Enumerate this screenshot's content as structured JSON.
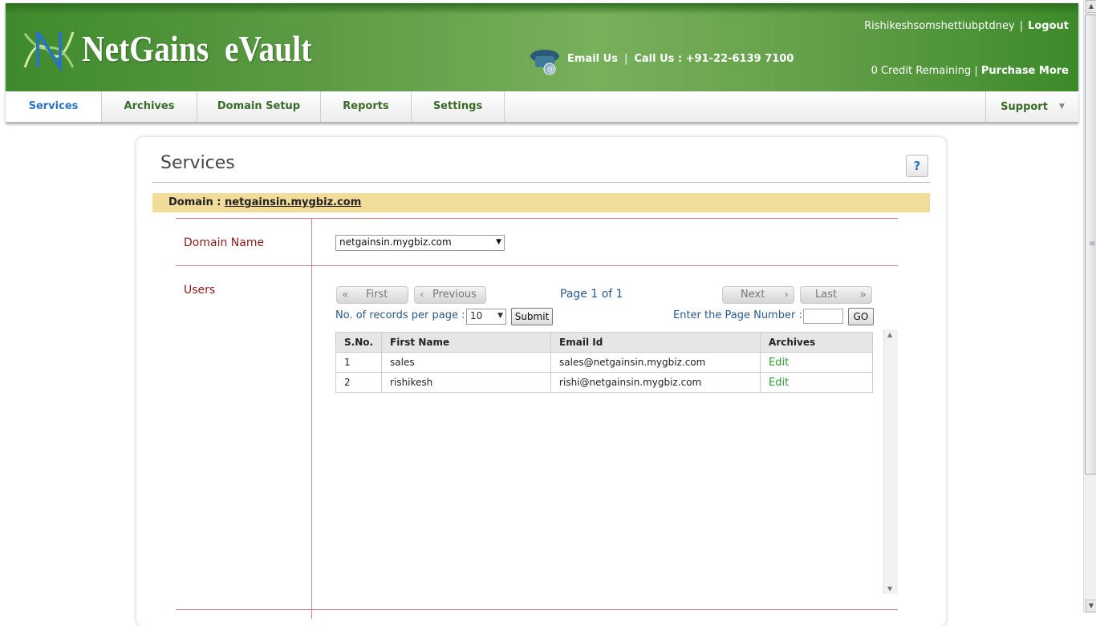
{
  "header": {
    "logo_text": "NetGains  eVault",
    "email_us": "Email Us",
    "separator": "|",
    "call_us": "Call Us : +91-22-6139 7100",
    "username": "Rishikeshsomshettiubptdney",
    "logout": "Logout",
    "credit_text": "0 Credit Remaining |",
    "purchase_more": "Purchase More"
  },
  "nav": {
    "items": [
      {
        "label": "Services"
      },
      {
        "label": "Archives"
      },
      {
        "label": "Domain Setup"
      },
      {
        "label": "Reports"
      },
      {
        "label": "Settings"
      }
    ],
    "support": "Support",
    "active": "Services"
  },
  "page": {
    "title": "Services",
    "help": "?",
    "domain_label": "Domain :",
    "domain_value": "netgainsin.mygbiz.com",
    "domain_name_label": "Domain Name",
    "domain_select_value": "netgainsin.mygbiz.com",
    "users_label": "Users"
  },
  "pager": {
    "first": "First",
    "previous": "Previous",
    "page_info": "Page 1 of 1",
    "next": "Next",
    "last": "Last",
    "rpp_label": "No. of records per page :",
    "rpp_value": "10",
    "submit": "Submit",
    "page_number_label": "Enter the Page Number :",
    "page_number_value": "",
    "go": "GO"
  },
  "table": {
    "headers": [
      "S.No.",
      "First Name",
      "Email Id",
      "Archives"
    ],
    "rows": [
      [
        "1",
        "sales",
        "sales@netgainsin.mygbiz.com",
        "Edit"
      ],
      [
        "2",
        "rishikesh",
        "rishi@netgainsin.mygbiz.com",
        "Edit"
      ]
    ]
  },
  "colors": {
    "header_green": "#5d9c45",
    "nav_active": "#2a74c8",
    "nav_text": "#3a6a2a",
    "domain_bar": "#f2dc9a",
    "label_red": "#8b1a1a",
    "edit_link": "#2a9a2a"
  }
}
